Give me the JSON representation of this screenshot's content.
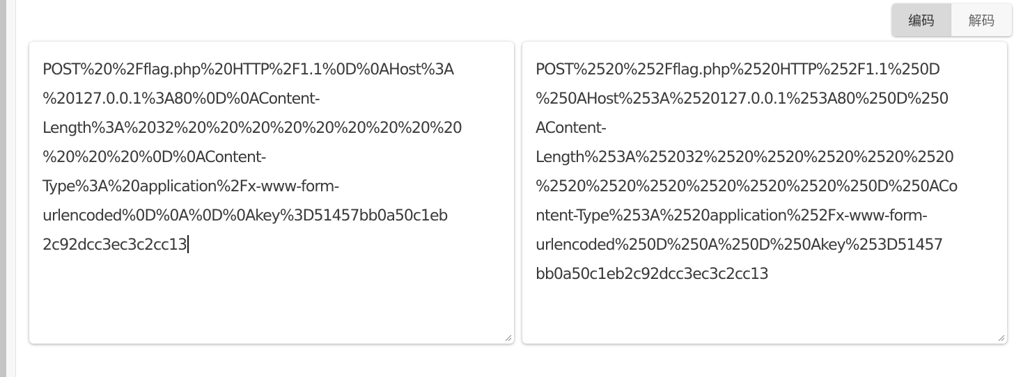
{
  "toolbar": {
    "encode_label": "编码",
    "decode_label": "解码",
    "active_mode": "encode"
  },
  "input_panel": {
    "lines": [
      "POST%20%2Fflag.php%20HTTP%2F1.1%0D%0AHost%3A",
      "%20127.0.0.1%3A80%0D%0AContent-",
      "Length%3A%2032%20%20%20%20%20%20%20%20%20",
      "%20%20%20%0D%0AContent-",
      "Type%3A%20application%2Fx-www-form-",
      "urlencoded%0D%0A%0D%0Akey%3D51457bb0a50c1eb",
      "2c92dcc3ec3c2cc13"
    ]
  },
  "output_panel": {
    "lines": [
      "POST%2520%252Fflag.php%2520HTTP%252F1.1%250D",
      "%250AHost%253A%2520127.0.0.1%253A80%250D%250",
      "AContent-",
      "Length%253A%252032%2520%2520%2520%2520%2520",
      "%2520%2520%2520%2520%2520%2520%250D%250ACo",
      "ntent-Type%253A%2520application%252Fx-www-form-",
      "urlencoded%250D%250A%250D%250Akey%253D51457",
      "bb0a50c1eb2c92dcc3ec3c2cc13"
    ]
  },
  "colors": {
    "active_button_bg": "#d9d9d9",
    "inactive_button_bg": "#f7f7f7",
    "text": "#3a3a3a"
  }
}
